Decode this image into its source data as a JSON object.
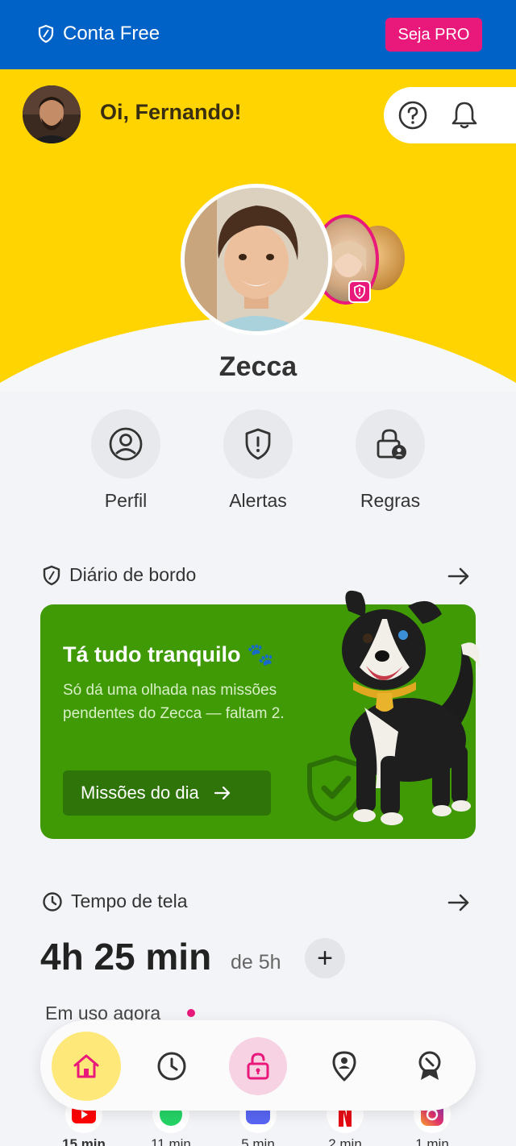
{
  "topbar": {
    "account_label": "Conta Free",
    "pro_label": "Seja PRO"
  },
  "header": {
    "greeting": "Oi, Fernando!"
  },
  "child": {
    "name": "Zecca"
  },
  "actions": [
    {
      "label": "Perfil",
      "icon": "profile-icon"
    },
    {
      "label": "Alertas",
      "icon": "shield-alert-icon"
    },
    {
      "label": "Regras",
      "icon": "lock-user-icon"
    }
  ],
  "diary": {
    "title": "Diário de bordo",
    "card_title": "Tá tudo tranquilo 🐾",
    "card_text": "Só dá uma olhada nas missões pendentes do Zecca — faltam 2.",
    "button_label": "Missões do dia"
  },
  "screen_time": {
    "title": "Tempo de tela",
    "used": "4h 25 min",
    "limit": "de 5h",
    "in_use_label": "Em uso agora",
    "apps": [
      {
        "icon": "youtube-icon",
        "minutes": "15 min"
      },
      {
        "icon": "whatsapp-icon",
        "minutes": "11 min"
      },
      {
        "icon": "discord-icon",
        "minutes": "5 min"
      },
      {
        "icon": "netflix-icon",
        "minutes": "2 min"
      },
      {
        "icon": "instagram-icon",
        "minutes": "1 min"
      }
    ]
  },
  "nav": [
    "home-icon",
    "clock-icon",
    "lock-icon",
    "location-icon",
    "achievements-icon"
  ],
  "colors": {
    "brand_blue": "#0062c7",
    "brand_yellow": "#ffd400",
    "accent_pink": "#e8197a",
    "card_green": "#3f9a06"
  }
}
